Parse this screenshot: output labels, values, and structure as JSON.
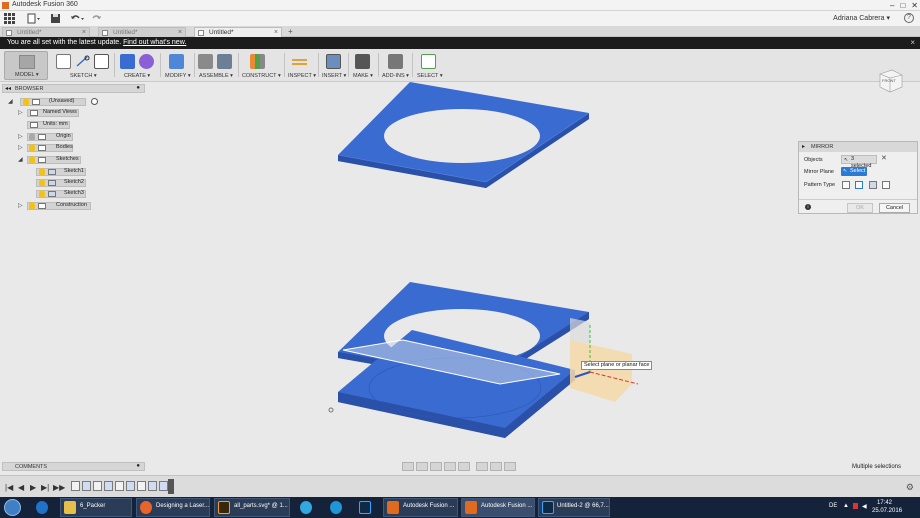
{
  "window": {
    "title": "Autodesk Fusion 360",
    "controls": [
      "–",
      "□",
      "✕"
    ]
  },
  "quickbar": {
    "icons": [
      "grid-menu-icon",
      "file-icon",
      "save-icon",
      "undo-icon",
      "redo-icon"
    ],
    "user": "Adriana Cabrera ▾",
    "help": "?"
  },
  "tabs": [
    {
      "label": "Untitled*",
      "active": false
    },
    {
      "label": "Untitled*",
      "active": false
    },
    {
      "label": "Untitled*",
      "active": true
    }
  ],
  "tab_add": "+",
  "update_bar": {
    "message": "You are all set with the latest update.",
    "link": "Find out what's new.",
    "close": "×"
  },
  "toolbar": {
    "model_label": "MODEL ▾",
    "groups": [
      {
        "label": "SKETCH ▾"
      },
      {
        "label": "CREATE ▾"
      },
      {
        "label": "MODIFY ▾"
      },
      {
        "label": "ASSEMBLE ▾"
      },
      {
        "label": "CONSTRUCT ▾"
      },
      {
        "label": "INSPECT ▾"
      },
      {
        "label": "INSERT ▾"
      },
      {
        "label": "MAKE ▾"
      },
      {
        "label": "ADD-INS ▾"
      },
      {
        "label": "SELECT ▾"
      }
    ]
  },
  "viewcube": {
    "label": "FRONT"
  },
  "browser": {
    "title": "BROWSER",
    "items": [
      {
        "label": "(Unsaved)"
      },
      {
        "label": "Named Views"
      },
      {
        "label": "Units: mm"
      },
      {
        "label": "Origin"
      },
      {
        "label": "Bodies"
      },
      {
        "label": "Sketches"
      },
      {
        "label": "Sketch1"
      },
      {
        "label": "Sketch2"
      },
      {
        "label": "Sketch3"
      },
      {
        "label": "Construction"
      }
    ]
  },
  "comments": {
    "title": "COMMENTS"
  },
  "mirror": {
    "title": "MIRROR",
    "objects_label": "Objects",
    "objects_value": "3 selected",
    "objects_clear": "✕",
    "plane_label": "Mirror Plane",
    "plane_value": "Select",
    "pattern_label": "Pattern Type",
    "info": "i",
    "ok": "OK",
    "cancel": "Cancel"
  },
  "tooltip": "Select plane or planar face",
  "status": "Multiple selections",
  "timeline": {
    "controls": [
      "|◀",
      "◀",
      "▶",
      "▶|",
      "▶▶"
    ],
    "gear": "⚙"
  },
  "taskbar": {
    "items": [
      {
        "label": "6_Packer"
      },
      {
        "label": "Designing a Laser..."
      },
      {
        "label": "all_parts.svg* @ 1..."
      },
      {
        "label": "Autodesk Fusion ..."
      },
      {
        "label": "Autodesk Fusion ..."
      },
      {
        "label": "Untitled-2 @ 66,7..."
      }
    ],
    "lang": "DE",
    "time": "17:42",
    "date": "25.07.2016"
  },
  "colors": {
    "body_blue": "#3a6bd0",
    "body_blue_dark": "#2a50a8",
    "plane_orange": "#f6d9a8",
    "select_blue": "#2c7bd2"
  }
}
